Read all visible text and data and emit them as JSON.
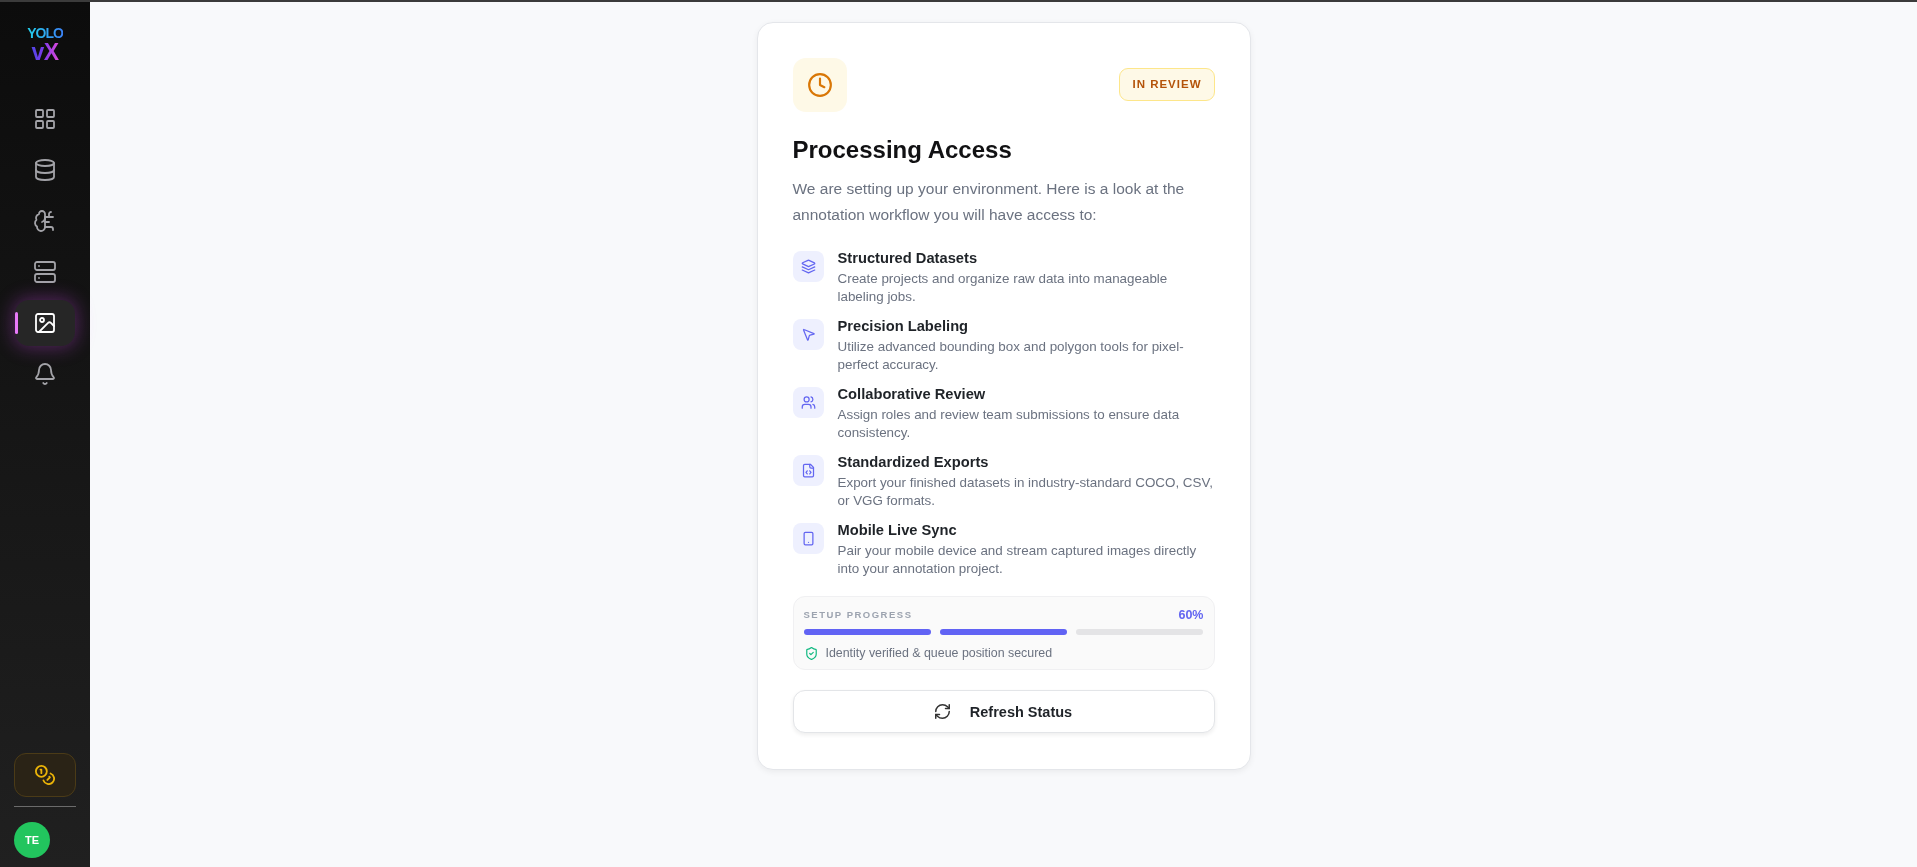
{
  "sidebar": {
    "logo": {
      "line_1": "YOLO",
      "line_2": "vX"
    },
    "nav_items": [
      {
        "selected": false
      },
      {
        "selected": false
      },
      {
        "selected": false
      },
      {
        "selected": false
      },
      {
        "selected": true
      },
      {
        "selected": false
      }
    ],
    "avatar": {
      "initials": "TE"
    }
  },
  "card": {
    "status_badge": "IN REVIEW",
    "title": "Processing Access",
    "description": "We are setting up your environment. Here is a look at the annotation workflow you will have access to:",
    "features": [
      {
        "title": "Structured Datasets",
        "description": "Create projects and organize raw data into manageable labeling jobs."
      },
      {
        "title": "Precision Labeling",
        "description": "Utilize advanced bounding box and polygon tools for pixel-perfect accuracy."
      },
      {
        "title": "Collaborative Review",
        "description": "Assign roles and review team submissions to ensure data consistency."
      },
      {
        "title": "Standardized Exports",
        "description": "Export your finished datasets in industry-standard COCO, CSV, or VGG formats."
      },
      {
        "title": "Mobile Live Sync",
        "description": "Pair your mobile device and stream captured images directly into your annotation project."
      }
    ],
    "progress": {
      "label": "SETUP PROGRESS",
      "percent": "60%",
      "segments": [
        {
          "complete": true
        },
        {
          "complete": true
        },
        {
          "complete": false
        }
      ],
      "note": "Identity verified & queue position secured"
    },
    "refresh_button": "Refresh Status"
  }
}
